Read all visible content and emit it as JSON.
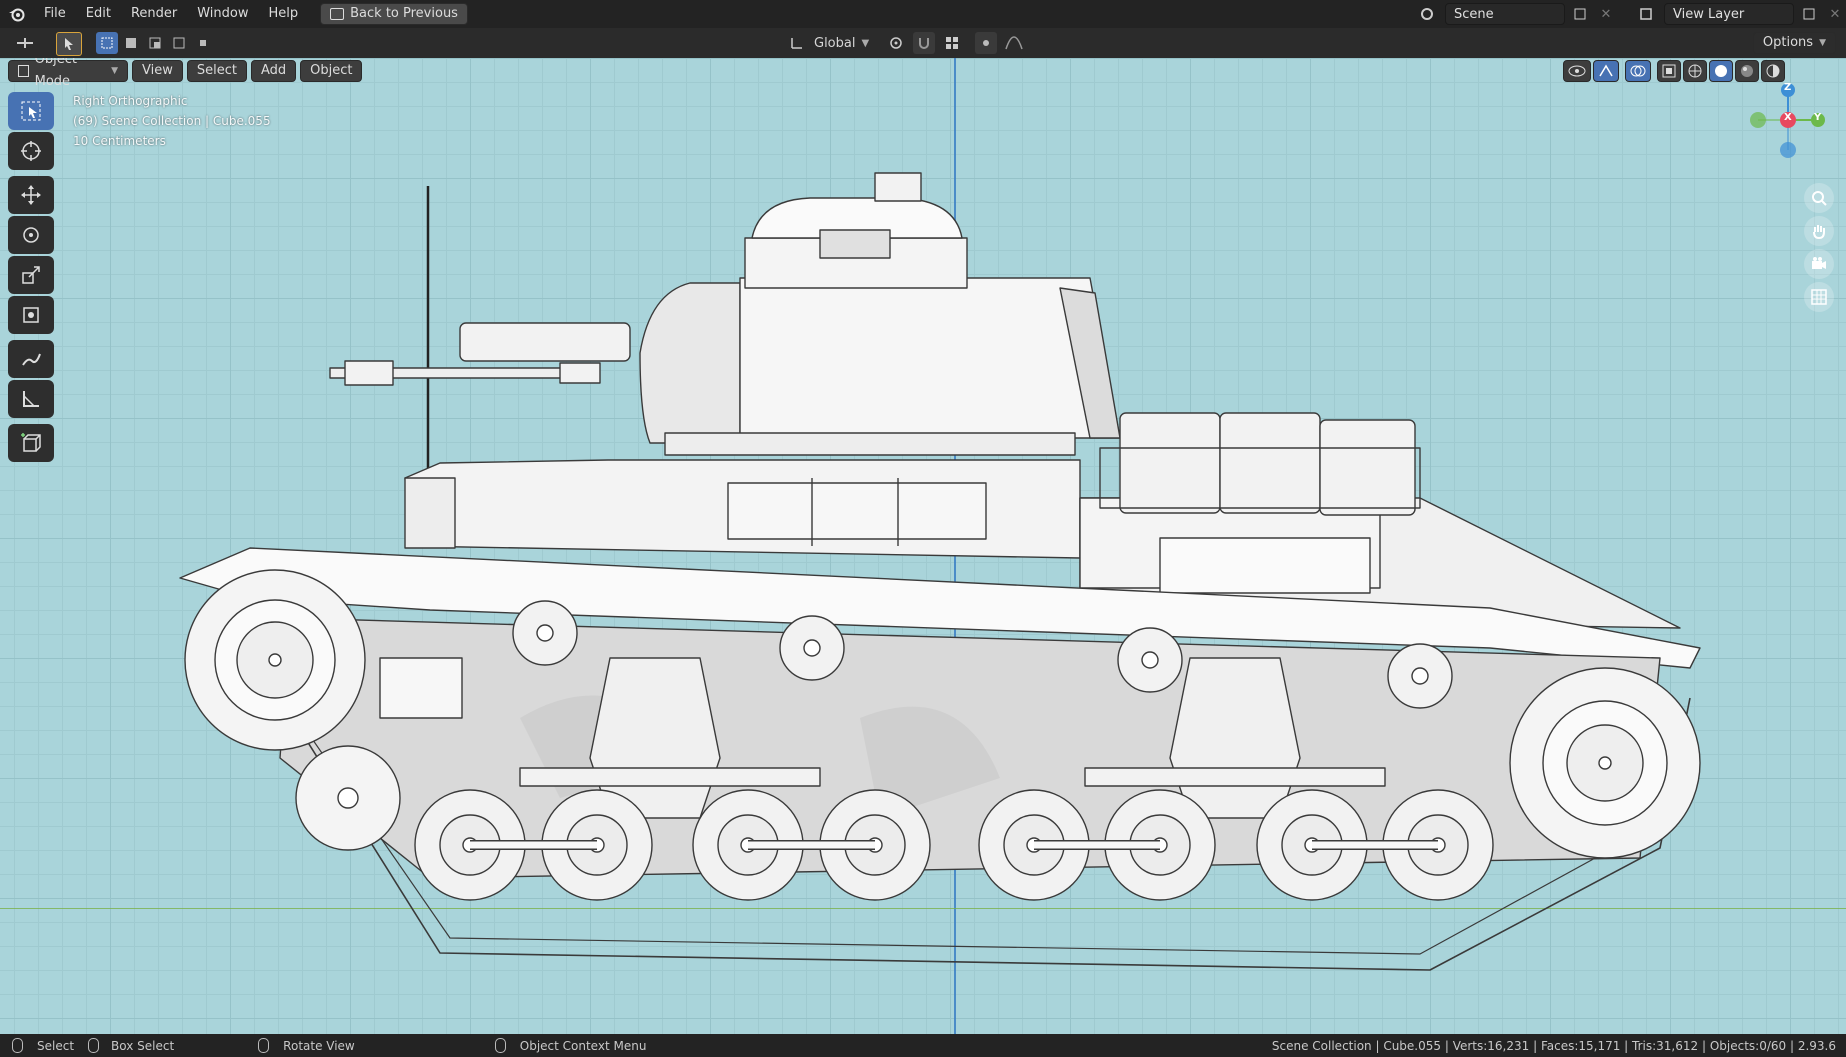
{
  "menu": {
    "items": [
      "File",
      "Edit",
      "Render",
      "Window",
      "Help"
    ],
    "back_label": "Back to Previous"
  },
  "scene": {
    "label": "Scene"
  },
  "view_layer": {
    "label": "View Layer"
  },
  "header": {
    "transform_orientation": "Global",
    "options_label": "Options"
  },
  "viewport_header": {
    "mode": "Object Mode",
    "view": "View",
    "select": "Select",
    "add": "Add",
    "object": "Object"
  },
  "overlay": {
    "view_name": "Right Orthographic",
    "collection": "(69) Scene Collection | Cube.055",
    "scale": "10 Centimeters"
  },
  "gizmo": {
    "z": "Z",
    "y": "Y",
    "x": "X"
  },
  "status": {
    "select": "Select",
    "box_select": "Box Select",
    "rotate_view": "Rotate View",
    "context_menu": "Object Context Menu",
    "stats": "Scene Collection | Cube.055 | Verts:16,231 | Faces:15,171 | Tris:31,612 | Objects:0/60 | 2.93.6"
  },
  "colors": {
    "viewport_bg": "#a9d4da",
    "accent": "#4772b3",
    "axis_x": "#e8495f",
    "axis_y": "#6cb94a",
    "axis_z": "#3d8fd6"
  }
}
